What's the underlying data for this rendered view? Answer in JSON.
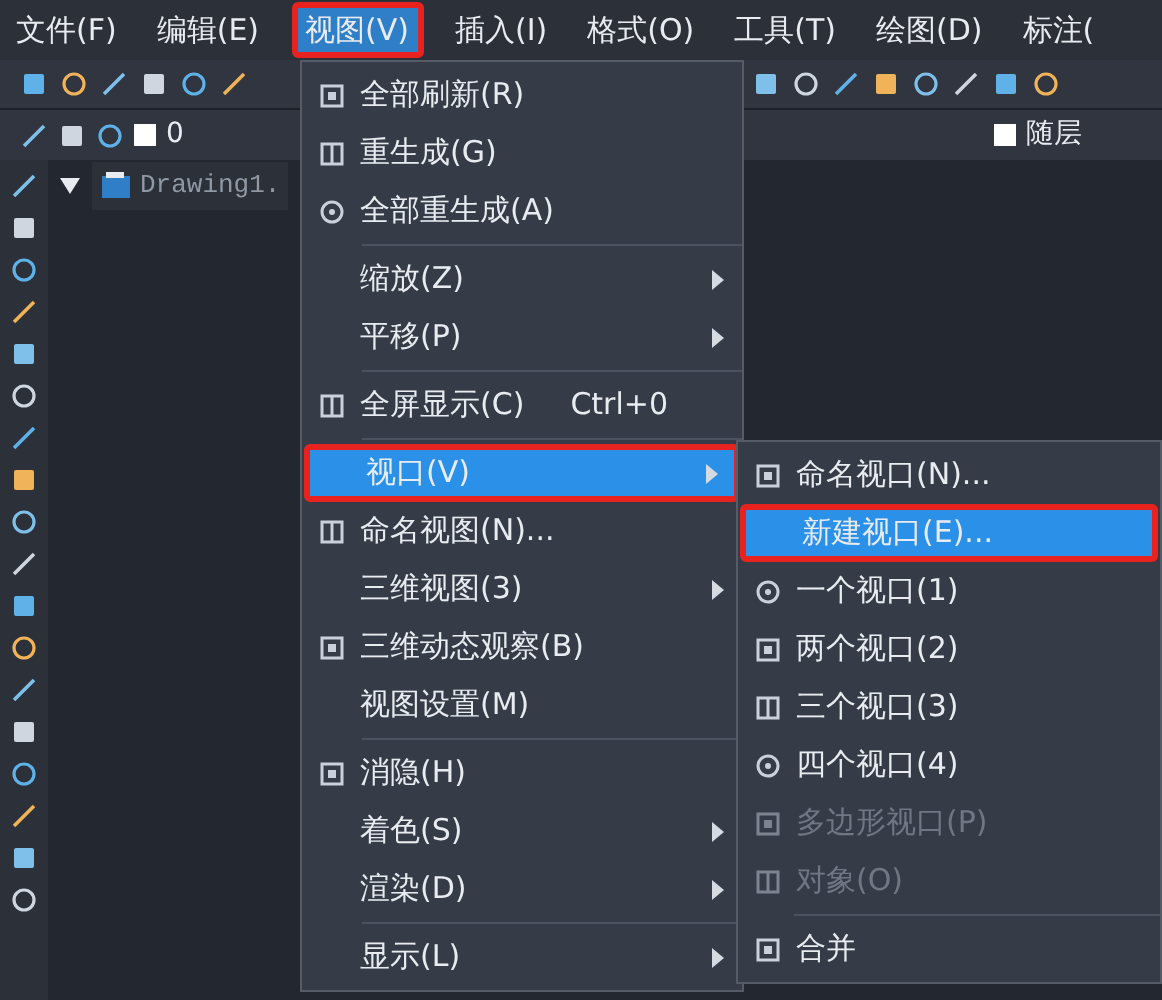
{
  "menubar": [
    {
      "label": "文件(F)",
      "selected": false,
      "annotated": false
    },
    {
      "label": "编辑(E)",
      "selected": false,
      "annotated": false
    },
    {
      "label": "视图(V)",
      "selected": true,
      "annotated": true
    },
    {
      "label": "插入(I)",
      "selected": false,
      "annotated": false
    },
    {
      "label": "格式(O)",
      "selected": false,
      "annotated": false
    },
    {
      "label": "工具(T)",
      "selected": false,
      "annotated": false
    },
    {
      "label": "绘图(D)",
      "selected": false,
      "annotated": false
    },
    {
      "label": "标注(",
      "selected": false,
      "annotated": false
    }
  ],
  "layer_bar": {
    "layer": "0",
    "linetype": "随层"
  },
  "document_tab": {
    "title": "Drawing1."
  },
  "view_menu": {
    "items": [
      {
        "kind": "item",
        "label": "全部刷新(R)",
        "icon": true,
        "submenu": false,
        "selected": false,
        "annotated": false
      },
      {
        "kind": "item",
        "label": "重生成(G)",
        "icon": true,
        "submenu": false,
        "selected": false,
        "annotated": false
      },
      {
        "kind": "item",
        "label": "全部重生成(A)",
        "icon": true,
        "submenu": false,
        "selected": false,
        "annotated": false
      },
      {
        "kind": "separator"
      },
      {
        "kind": "item",
        "label": "缩放(Z)",
        "icon": false,
        "submenu": true,
        "selected": false,
        "annotated": false
      },
      {
        "kind": "item",
        "label": "平移(P)",
        "icon": false,
        "submenu": true,
        "selected": false,
        "annotated": false
      },
      {
        "kind": "separator"
      },
      {
        "kind": "item",
        "label": "全屏显示(C)",
        "shortcut": "Ctrl+0",
        "icon": true,
        "submenu": false,
        "selected": false,
        "annotated": false
      },
      {
        "kind": "separator"
      },
      {
        "kind": "item",
        "label": "视口(V)",
        "icon": false,
        "submenu": true,
        "selected": true,
        "annotated": true
      },
      {
        "kind": "item",
        "label": "命名视图(N)...",
        "icon": true,
        "submenu": false,
        "selected": false,
        "annotated": false
      },
      {
        "kind": "item",
        "label": "三维视图(3)",
        "icon": false,
        "submenu": true,
        "selected": false,
        "annotated": false
      },
      {
        "kind": "item",
        "label": "三维动态观察(B)",
        "icon": true,
        "submenu": false,
        "selected": false,
        "annotated": false
      },
      {
        "kind": "item",
        "label": "视图设置(M)",
        "icon": false,
        "submenu": false,
        "selected": false,
        "annotated": false
      },
      {
        "kind": "separator"
      },
      {
        "kind": "item",
        "label": "消隐(H)",
        "icon": true,
        "submenu": false,
        "selected": false,
        "annotated": false
      },
      {
        "kind": "item",
        "label": "着色(S)",
        "icon": false,
        "submenu": true,
        "selected": false,
        "annotated": false
      },
      {
        "kind": "item",
        "label": "渲染(D)",
        "icon": false,
        "submenu": true,
        "selected": false,
        "annotated": false
      },
      {
        "kind": "separator"
      },
      {
        "kind": "item",
        "label": "显示(L)",
        "icon": false,
        "submenu": true,
        "selected": false,
        "annotated": false
      }
    ]
  },
  "viewport_submenu": {
    "items": [
      {
        "kind": "item",
        "label": "命名视口(N)...",
        "icon": true,
        "disabled": false,
        "selected": false,
        "annotated": false
      },
      {
        "kind": "item",
        "label": "新建视口(E)...",
        "icon": false,
        "disabled": false,
        "selected": true,
        "annotated": true
      },
      {
        "kind": "item",
        "label": "一个视口(1)",
        "icon": true,
        "disabled": false,
        "selected": false,
        "annotated": false
      },
      {
        "kind": "item",
        "label": "两个视口(2)",
        "icon": true,
        "disabled": false,
        "selected": false,
        "annotated": false
      },
      {
        "kind": "item",
        "label": "三个视口(3)",
        "icon": true,
        "disabled": false,
        "selected": false,
        "annotated": false
      },
      {
        "kind": "item",
        "label": "四个视口(4)",
        "icon": true,
        "disabled": false,
        "selected": false,
        "annotated": false
      },
      {
        "kind": "item",
        "label": "多边形视口(P)",
        "icon": true,
        "disabled": true,
        "selected": false,
        "annotated": false
      },
      {
        "kind": "item",
        "label": "对象(O)",
        "icon": true,
        "disabled": true,
        "selected": false,
        "annotated": false
      },
      {
        "kind": "separator"
      },
      {
        "kind": "item",
        "label": "合并",
        "icon": true,
        "disabled": false,
        "selected": false,
        "annotated": false
      }
    ]
  }
}
